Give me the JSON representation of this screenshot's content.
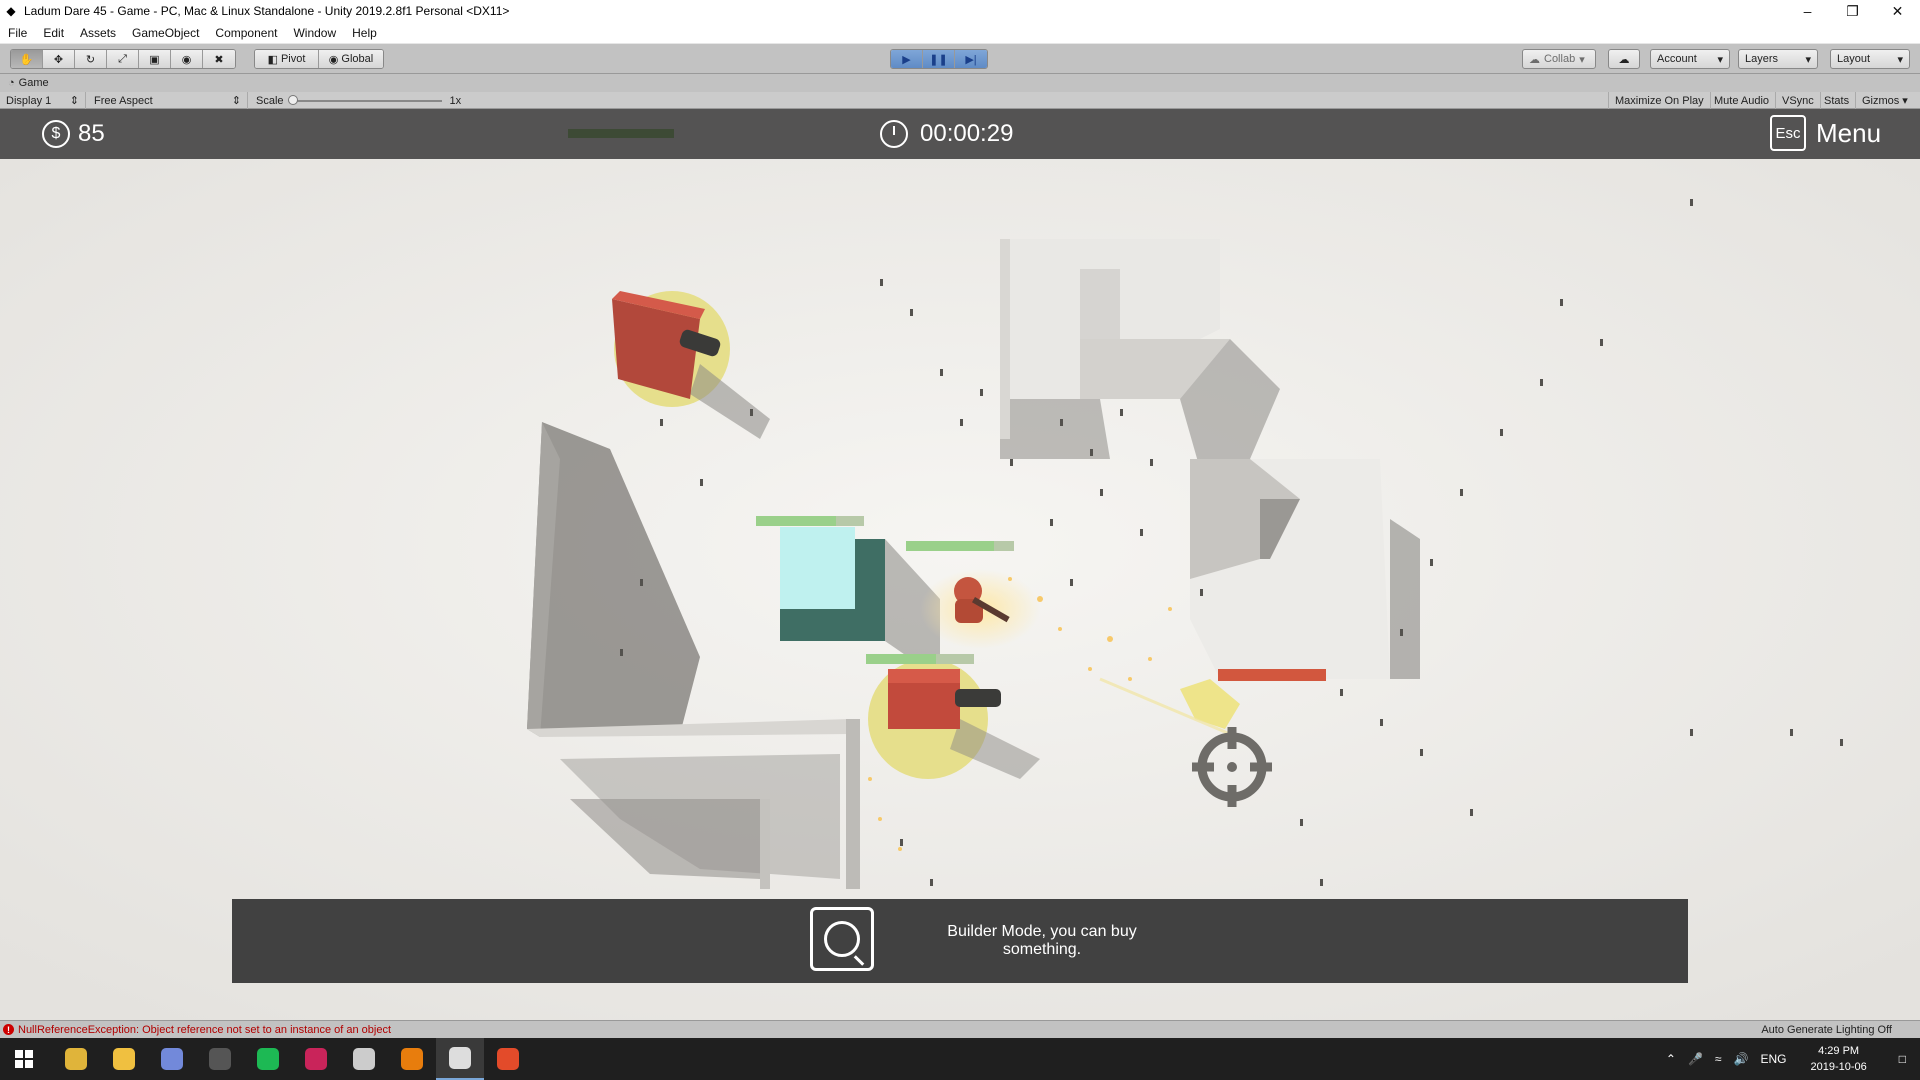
{
  "window": {
    "title": "Ladum Dare 45 - Game - PC, Mac & Linux Standalone - Unity 2019.2.8f1 Personal <DX11>"
  },
  "menu": [
    "File",
    "Edit",
    "Assets",
    "GameObject",
    "Component",
    "Window",
    "Help"
  ],
  "toolbar": {
    "pivot": "Pivot",
    "global": "Global",
    "collab": "Collab",
    "account": "Account",
    "layers": "Layers",
    "layout": "Layout"
  },
  "game_tab": {
    "label": "Game"
  },
  "game_bar": {
    "display": "Display 1",
    "aspect": "Free Aspect",
    "scale_label": "Scale",
    "scale_value": "1x",
    "maximize": "Maximize On Play",
    "mute": "Mute Audio",
    "vsync": "VSync",
    "stats": "Stats",
    "gizmos": "Gizmos"
  },
  "hud": {
    "money": "85",
    "timer": "00:00:29",
    "esc_key": "Esc",
    "menu_label": "Menu"
  },
  "builder": {
    "key": "Q",
    "message": "Builder Mode, you can buy something."
  },
  "status": {
    "error": "NullReferenceException: Object reference not set to an instance of an object",
    "lighting": "Auto Generate Lighting Off"
  },
  "taskbar": {
    "lang": "ENG",
    "time": "4:29 PM",
    "date": "2019-10-06",
    "apps": [
      {
        "name": "chrome-icon",
        "color": "#e0b43a"
      },
      {
        "name": "file-explorer-icon",
        "color": "#f0c040"
      },
      {
        "name": "discord-icon",
        "color": "#7289da"
      },
      {
        "name": "obs-icon",
        "color": "#555555"
      },
      {
        "name": "spotify-icon",
        "color": "#1db954"
      },
      {
        "name": "rider-icon",
        "color": "#c9245a"
      },
      {
        "name": "unity-hub-icon",
        "color": "#cccccc"
      },
      {
        "name": "blender-icon",
        "color": "#e87d0d"
      },
      {
        "name": "unity-icon",
        "color": "#dddddd"
      },
      {
        "name": "app-icon",
        "color": "#e34b2a"
      }
    ]
  }
}
